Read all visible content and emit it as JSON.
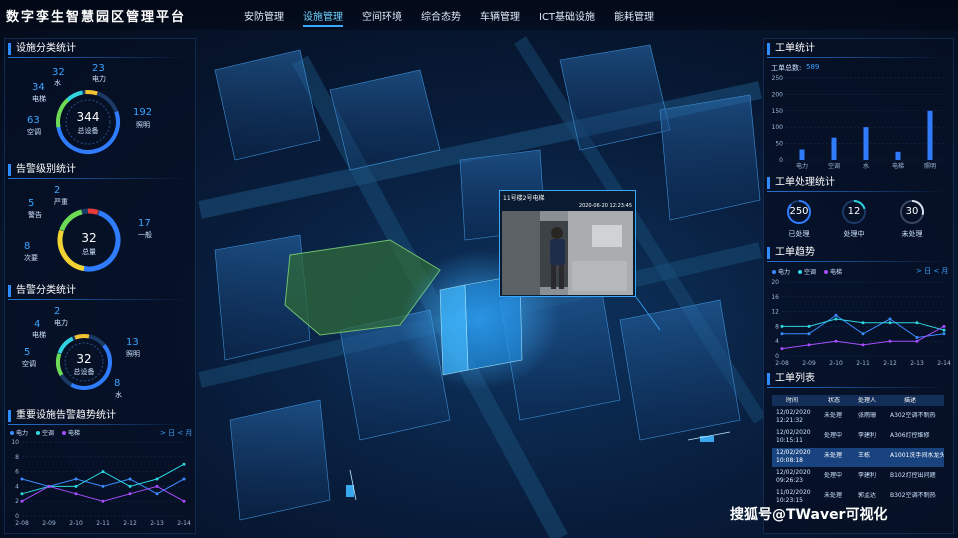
{
  "app": {
    "title": "数字孪生智慧园区管理平台"
  },
  "nav": [
    "安防管理",
    "设施管理",
    "空间环境",
    "综合态势",
    "车辆管理",
    "ICT基础设施",
    "能耗管理"
  ],
  "nav_active": 1,
  "facility_stats": {
    "title": "设施分类统计",
    "total": "344",
    "total_label": "总设备",
    "items": [
      {
        "value": "32",
        "label": "水"
      },
      {
        "value": "23",
        "label": "电力"
      },
      {
        "value": "34",
        "label": "电梯"
      },
      {
        "value": "63",
        "label": "空调"
      },
      {
        "value": "192",
        "label": "照明"
      }
    ]
  },
  "alarm_level": {
    "title": "告警级别统计",
    "total": "32",
    "total_label": "总量",
    "items": [
      {
        "value": "2",
        "label": "严重"
      },
      {
        "value": "5",
        "label": "警告"
      },
      {
        "value": "17",
        "label": "一般"
      },
      {
        "value": "8",
        "label": "次要"
      }
    ]
  },
  "alarm_category": {
    "title": "告警分类统计",
    "total": "32",
    "total_label": "总设备",
    "items": [
      {
        "value": "2",
        "label": "电力"
      },
      {
        "value": "4",
        "label": "电梯"
      },
      {
        "value": "13",
        "label": "照明"
      },
      {
        "value": "5",
        "label": "空调"
      },
      {
        "value": "8",
        "label": "水"
      }
    ]
  },
  "trend_left": {
    "title": "重要设施告警趋势统计",
    "toggle": "> 日 < 月"
  },
  "workorder_stats": {
    "title": "工单统计",
    "total_label": "工单总数:",
    "total": "589"
  },
  "workorder_process": {
    "title": "工单处理统计",
    "items": [
      {
        "value": "250",
        "label": "已处理"
      },
      {
        "value": "12",
        "label": "处理中"
      },
      {
        "value": "30",
        "label": "未处理"
      }
    ]
  },
  "workorder_trend": {
    "title": "工单趋势",
    "toggle": "> 日 < 月"
  },
  "workorder_list": {
    "title": "工单列表",
    "headers": [
      "时间",
      "状态",
      "处理人",
      "描述"
    ],
    "rows": [
      {
        "date": "12/02/2020",
        "time": "12:21:32",
        "status": "未处理",
        "person": "张雨珊",
        "desc": "A302空调不制热"
      },
      {
        "date": "12/02/2020",
        "time": "10:15:11",
        "status": "处理中",
        "person": "李建利",
        "desc": "A306灯控维修"
      },
      {
        "date": "12/02/2020",
        "time": "10:08:18",
        "status": "未处理",
        "person": "王栋",
        "desc": "A1001洗手间水龙头关不上"
      },
      {
        "date": "12/02/2020",
        "time": "09:26:23",
        "status": "处理中",
        "person": "李建利",
        "desc": "B102灯控出问题"
      },
      {
        "date": "11/02/2020",
        "time": "10:23:15",
        "status": "未处理",
        "person": "郭孟达",
        "desc": "B302空调不制热"
      }
    ],
    "selected": 2
  },
  "video": {
    "title": "11号楼2号电梯",
    "timestamp": "2020-06-20  12:23:45"
  },
  "watermark": "搜狐号@TWaver可视化",
  "chart_data": [
    {
      "type": "line",
      "title": "重要设施告警趋势统计",
      "x": [
        "2-08",
        "2-09",
        "2-10",
        "2-11",
        "2-12",
        "2-13",
        "2-14"
      ],
      "ylim": [
        0,
        10
      ],
      "yticks": [
        0,
        2,
        4,
        6,
        8,
        10
      ],
      "series": [
        {
          "name": "电力",
          "color": "#3b8cff",
          "values": [
            5,
            4,
            5,
            4,
            5,
            3,
            5
          ]
        },
        {
          "name": "空调",
          "color": "#2fd6e0",
          "values": [
            3,
            4,
            4,
            6,
            4,
            5,
            7
          ]
        },
        {
          "name": "电梯",
          "color": "#a64dff",
          "values": [
            2,
            4,
            3,
            2,
            3,
            4,
            2
          ]
        }
      ]
    },
    {
      "type": "bar",
      "title": "工单统计",
      "categories": [
        "电力",
        "空调",
        "水",
        "电梯",
        "照明"
      ],
      "values": [
        32,
        68,
        100,
        25,
        150
      ],
      "ylim": [
        0,
        250
      ],
      "yticks": [
        0,
        50,
        100,
        150,
        200,
        250
      ],
      "color": "#2f7cff"
    },
    {
      "type": "line",
      "title": "工单趋势",
      "x": [
        "2-08",
        "2-09",
        "2-10",
        "2-11",
        "2-12",
        "2-13",
        "2-14"
      ],
      "ylim": [
        0,
        20
      ],
      "yticks": [
        0,
        4,
        8,
        12,
        16,
        20
      ],
      "series": [
        {
          "name": "电力",
          "color": "#3b8cff",
          "values": [
            6,
            6,
            11,
            6,
            10,
            5,
            6
          ]
        },
        {
          "name": "空调",
          "color": "#2fd6e0",
          "values": [
            8,
            8,
            10,
            9,
            9,
            9,
            7
          ]
        },
        {
          "name": "电梯",
          "color": "#a64dff",
          "values": [
            2,
            3,
            4,
            3,
            4,
            4,
            8
          ]
        }
      ]
    }
  ]
}
